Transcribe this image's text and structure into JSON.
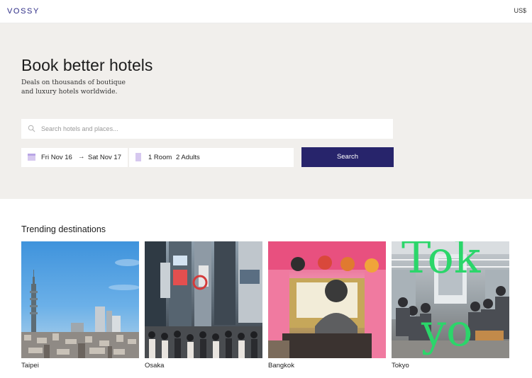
{
  "header": {
    "logo": "VOSSY",
    "currency": "US$"
  },
  "hero": {
    "title": "Book better hotels",
    "subtitle_line1": "Deals on thousands of boutique",
    "subtitle_line2": "and luxury hotels worldwide."
  },
  "search": {
    "placeholder": "Search hotels and places..."
  },
  "dates": {
    "check_in": "Fri Nov 16",
    "check_out": "Sat Nov 17"
  },
  "guests": {
    "rooms": "1 Room",
    "adults": "2 Adults"
  },
  "search_button": {
    "label": "Search"
  },
  "trending": {
    "title": "Trending destinations",
    "items": [
      {
        "label": "Taipei"
      },
      {
        "label": "Osaka"
      },
      {
        "label": "Bangkok"
      },
      {
        "label": "Tokyo",
        "overlay_text": [
          "Tok",
          "yo"
        ]
      }
    ]
  },
  "colors": {
    "brand": "#27246b",
    "hero_bg": "#f1efec",
    "overlay_green": "#2bd66a"
  }
}
